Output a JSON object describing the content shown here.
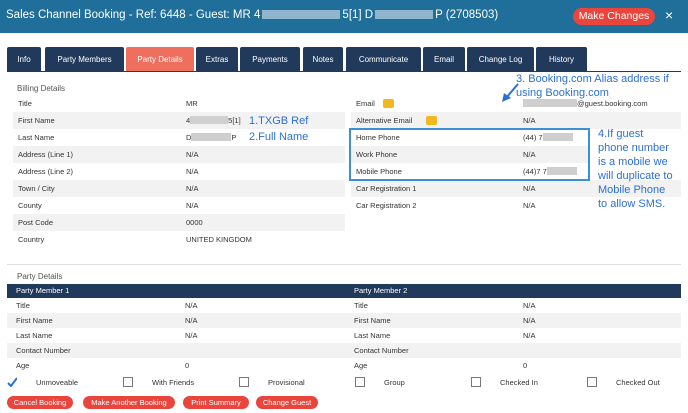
{
  "header": {
    "title_prefix": "Sales Channel Booking - Ref: 6448 - Guest: MR 4",
    "title_mid": "5[1] D",
    "title_suffix": "P (2708503)",
    "make_changes": "Make Changes",
    "close": "×"
  },
  "tabs": [
    "Info",
    "Party Members",
    "Party Details",
    "Extras",
    "Payments",
    "Notes",
    "Communicate",
    "Email",
    "Change Log",
    "History"
  ],
  "active_tab": "Party Details",
  "billing": {
    "section_label": "Billing Details",
    "left": [
      {
        "label": "Title",
        "value": "MR"
      },
      {
        "label": "First Name",
        "value": "4",
        "value_end": "5[1]"
      },
      {
        "label": "Last Name",
        "value": "D",
        "value_end": "P"
      },
      {
        "label": "Address (Line 1)",
        "value": "N/A"
      },
      {
        "label": "Address (Line 2)",
        "value": "N/A"
      },
      {
        "label": "Town / City",
        "value": "N/A"
      },
      {
        "label": "County",
        "value": "N/A"
      },
      {
        "label": "Post Code",
        "value": "0000"
      },
      {
        "label": "Country",
        "value": "UNITED KINGDOM"
      }
    ],
    "right": [
      {
        "label": "Email",
        "value": "@guest.booking.com"
      },
      {
        "label": "Alternative Email",
        "value": "N/A"
      },
      {
        "label": "Home Phone",
        "value": "(44) 7"
      },
      {
        "label": "Work Phone",
        "value": "N/A"
      },
      {
        "label": "Mobile Phone",
        "value": "(44)7 7"
      },
      {
        "label": "Car Registration 1",
        "value": "N/A"
      },
      {
        "label": "Car Registration 2",
        "value": "N/A"
      }
    ]
  },
  "annotations": {
    "a1": "1.TXGB Ref",
    "a2": "2.Full Name",
    "a3_line1": "3. Booking.com Alias address if",
    "a3_line2": "using Booking.com",
    "a4_lines": [
      "4.If guest",
      "phone number",
      "is a mobile we",
      "will duplicate to",
      "Mobile Phone",
      "to allow SMS."
    ]
  },
  "party": {
    "section_label": "Party Details",
    "col1_header": "Party Member 1",
    "col2_header": "Party Member 2",
    "rows": [
      {
        "label": "Title",
        "v1": "N/A",
        "v2": "N/A"
      },
      {
        "label": "First Name",
        "v1": "N/A",
        "v2": "N/A"
      },
      {
        "label": "Last Name",
        "v1": "N/A",
        "v2": "N/A"
      },
      {
        "label": "Contact Number",
        "v1": "",
        "v2": ""
      },
      {
        "label": "Age",
        "v1": "0",
        "v2": "0"
      }
    ]
  },
  "checkboxes": [
    {
      "label": "Unmoveable",
      "checked": true
    },
    {
      "label": "With Friends",
      "checked": false
    },
    {
      "label": "Provisional",
      "checked": false
    },
    {
      "label": "Group",
      "checked": false
    },
    {
      "label": "Checked In",
      "checked": false
    },
    {
      "label": "Checked Out",
      "checked": false
    }
  ],
  "buttons": [
    "Cancel Booking",
    "Make Another Booking",
    "Print Summary",
    "Change Guest"
  ],
  "colors": {
    "title_bar": "#1f6f9a",
    "tab_bg": "#213a5c",
    "tab_active": "#ef6f5f",
    "accent_red": "#e9453d",
    "annotation_blue": "#2c6fd6"
  },
  "icons": {
    "thumbs_up": "thumbs-up-icon",
    "arrow": "arrow-icon",
    "check": "check-icon"
  }
}
